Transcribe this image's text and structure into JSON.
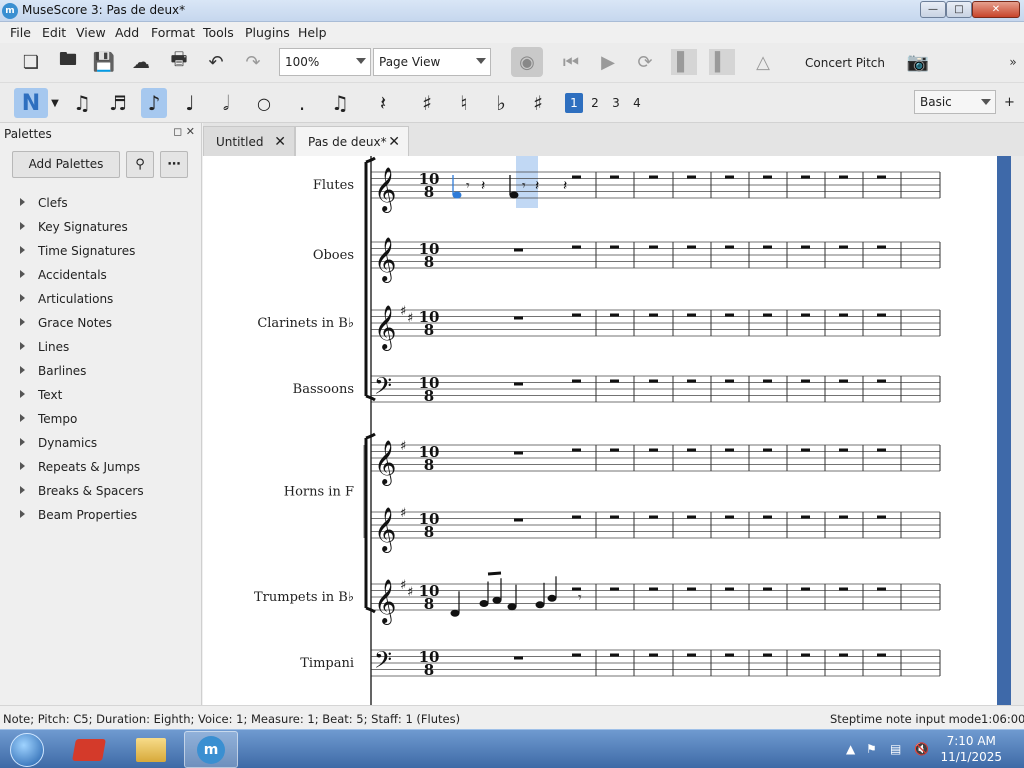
{
  "window": {
    "title": "MuseScore 3: Pas de deux*",
    "app_icon": "musescore-icon"
  },
  "menu": [
    "File",
    "Edit",
    "View",
    "Add",
    "Format",
    "Tools",
    "Plugins",
    "Help"
  ],
  "toolbar": {
    "zoom_value": "100%",
    "view_mode": "Page View",
    "concert_pitch": "Concert Pitch"
  },
  "note_toolbar": {
    "voices": [
      "1",
      "2",
      "3",
      "4"
    ],
    "active_voice": "1",
    "workspace": "Basic",
    "add": "+"
  },
  "palettes": {
    "header": "Palettes",
    "add_button": "Add Palettes",
    "items": [
      "Clefs",
      "Key Signatures",
      "Time Signatures",
      "Accidentals",
      "Articulations",
      "Grace Notes",
      "Lines",
      "Barlines",
      "Text",
      "Tempo",
      "Dynamics",
      "Repeats & Jumps",
      "Breaks & Spacers",
      "Beam Properties"
    ]
  },
  "tabs": [
    {
      "label": "Untitled"
    },
    {
      "label": "Pas de deux*"
    }
  ],
  "score": {
    "time_sig_top": "10",
    "time_sig_bottom": "8",
    "instruments": [
      "Flutes",
      "Oboes",
      "Clarinets in B♭",
      "Bassoons",
      "Horns in F",
      "Trumpets in B♭",
      "Timpani"
    ]
  },
  "status": {
    "left": "Note; Pitch: C5; Duration: Eighth; Voice: 1;  Measure: 1; Beat: 5; Staff: 1 (Flutes)",
    "mode": "Steptime note input mode",
    "time": "1:06:000"
  },
  "clock": {
    "time": "7:10 AM",
    "date": "11/1/2025"
  },
  "colors": {
    "accent": "#2e6fbf",
    "selection": "#a6c8ef",
    "scrollbar": "#3e69a9"
  }
}
